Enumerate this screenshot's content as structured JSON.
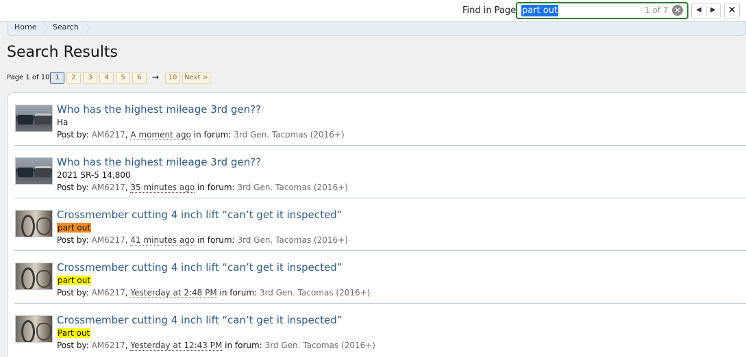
{
  "findbar": {
    "label": "Find in Page:",
    "query": "part out",
    "count": "1 of 7",
    "clear_icon": "×",
    "prev_icon": "◀",
    "next_icon": "▶",
    "close_icon": "✕"
  },
  "breadcrumb": [
    "Home",
    "Search"
  ],
  "page_title": "Search Results",
  "pagination": {
    "label": "Page 1 of 10",
    "pages": [
      "1",
      "2",
      "3",
      "4",
      "5",
      "6"
    ],
    "current": "1",
    "arrow": "→",
    "last": "10",
    "next": "Next >"
  },
  "results": [
    {
      "title": "Who has the highest mileage 3rd gen??",
      "snippet": "Ha",
      "highlight": "none",
      "thumb": "trucks",
      "author": "AM6217",
      "time": "A moment ago",
      "forum": "3rd Gen. Tacomas (2016+)"
    },
    {
      "title": "Who has the highest mileage 3rd gen??",
      "snippet": "2021 SR-5 14,800",
      "highlight": "none",
      "thumb": "trucks",
      "author": "AM6217",
      "time": "35 minutes ago",
      "forum": "3rd Gen. Tacomas (2016+)"
    },
    {
      "title": "Crossmember cutting 4 inch lift “can’t get it inspected”",
      "snippet": "part out",
      "highlight": "orange",
      "thumb": "parts",
      "author": "AM6217",
      "time": "41 minutes ago",
      "forum": "3rd Gen. Tacomas (2016+)"
    },
    {
      "title": "Crossmember cutting 4 inch lift “can’t get it inspected”",
      "snippet": "part out",
      "highlight": "yellow",
      "thumb": "parts",
      "author": "AM6217",
      "time": "Yesterday at 2:48 PM",
      "forum": "3rd Gen. Tacomas (2016+)"
    },
    {
      "title": "Crossmember cutting 4 inch lift “can’t get it inspected”",
      "snippet": "Part out",
      "highlight": "yellow",
      "thumb": "parts",
      "author": "AM6217",
      "time": "Yesterday at 12:43 PM",
      "forum": "3rd Gen. Tacomas (2016+)"
    }
  ],
  "labels": {
    "post_by": "Post by:",
    "in_forum": "in forum:"
  }
}
